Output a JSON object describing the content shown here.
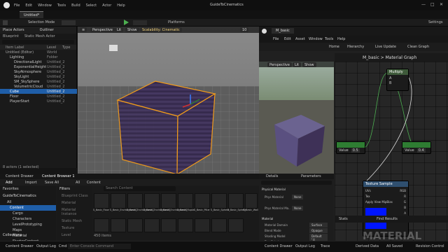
{
  "menu": {
    "items": [
      "File",
      "Edit",
      "Window",
      "Tools",
      "Build",
      "Select",
      "Actor",
      "Help"
    ],
    "project_title": "GuideToCinematics",
    "tab": "Untitled*"
  },
  "toolbar": {
    "selection_mode": "Selection Mode",
    "platforms": "Platforms",
    "settings": "Settings"
  },
  "outliner": {
    "tabs": [
      "Place Actors",
      "Outliner"
    ],
    "subtabs": [
      "Blueprint",
      "Static Mesh Actor"
    ],
    "columns": [
      "Item Label",
      "Level",
      "Type"
    ],
    "rows": [
      {
        "label": "Untitled (Editor)",
        "type": "World"
      },
      {
        "label": "Lighting",
        "type": "Folder"
      },
      {
        "label": "DirectionalLight",
        "type": "Untitled_2"
      },
      {
        "label": "ExponentialHeight",
        "type": "Untitled_2"
      },
      {
        "label": "SkyAtmosphere",
        "type": "Untitled_2"
      },
      {
        "label": "SkyLight",
        "type": "Untitled_2"
      },
      {
        "label": "SM_SkySphere",
        "type": "Untitled_2"
      },
      {
        "label": "VolumetricCloud",
        "type": "Untitled_2"
      },
      {
        "label": "Cube",
        "type": "Untitled_2"
      },
      {
        "label": "Floor",
        "type": "Untitled_2"
      },
      {
        "label": "PlayerStart",
        "type": "Untitled_2"
      }
    ],
    "footer": "8 actors (1 selected)"
  },
  "viewport": {
    "perspective": "Perspective",
    "lit": "Lit",
    "show": "Show",
    "scalability": "Scalability: Cinematic",
    "gizmo_value": "10"
  },
  "material_editor": {
    "tab": "M_basic",
    "menu": [
      "File",
      "Edit",
      "Asset",
      "Window",
      "Tools",
      "Help"
    ],
    "toolbar": [
      "Home",
      "Hierarchy",
      "Live Update",
      "Clean Graph"
    ],
    "graph_title": "M_basic > Material Graph",
    "zoom": "Zoom -1",
    "preview": {
      "perspective": "Perspective",
      "lit": "Lit",
      "show": "Show"
    },
    "details_tabs": [
      "Details",
      "Parameters"
    ],
    "details": {
      "section_physical": "Physical Material",
      "phys_material": "Phys Material",
      "phys_mat_map": "Phys Material Ma..",
      "none": "None",
      "section_material": "Material",
      "material_domain": "Material Domain",
      "surface": "Surface",
      "blend_mode": "Blend Mode",
      "opaque": "Opaque",
      "shading_model": "Shading Model",
      "default_lit": "Default Lit",
      "two_sided": "Two Sided",
      "use_material_attr": "Use Material Attri"
    },
    "nodes": {
      "multiply": "Multiply",
      "a": "A",
      "b": "B",
      "value_label": "Value",
      "v1": "0.5",
      "v2": "0.4",
      "texture_sample": "Texture Sample",
      "uvs": "UVs",
      "tex": "Tex",
      "apply_mip": "Apply View MipBias",
      "rgb": "RGB",
      "r": "R",
      "g": "G",
      "bb": "B",
      "al": "A",
      "rgba": "RGBA"
    },
    "bottom_tabs": [
      "Stats",
      "Find Results"
    ],
    "watermark": "MATERIAL"
  },
  "content": {
    "tabs": [
      "Content Drawer",
      "Content Browser 1"
    ],
    "add": "Add",
    "import": "Import",
    "save_all": "Save All",
    "path": [
      "All",
      "Content"
    ],
    "favorites": "Favorites",
    "project": "GuideToCinematics",
    "tree": [
      "All",
      "Content",
      "Cargo",
      "Characters",
      "LevelPrototyping",
      "Maps",
      "Material",
      "StarterContent"
    ],
    "filters": "Filters",
    "filter_items": [
      "Blueprint Class",
      "Material",
      "Material Instance",
      "Static Mesh",
      "Texture",
      "Level"
    ],
    "search": "Search Content",
    "count": "450 items",
    "collections": "Collections",
    "thumbs": [
      "S_Basic_Floor",
      "S_Basic_EnvironmentC",
      "S_Basic_EnvironmentC",
      "S_Basic_EnvironmentS",
      "S_Basic_EnvironmentS",
      "S_Basic_Rupta",
      "S_Basic_Pillar",
      "S_Basic_Sphere",
      "S_Basic_Sphere",
      "S_Basic_Wall"
    ]
  },
  "statusbar": {
    "content_drawer": "Content Drawer",
    "output_log": "Output Log",
    "cmd": "Cmd",
    "console_placeholder": "Enter Console Command",
    "trace": "Trace",
    "derived_data": "Derived Data",
    "all_saved": "All Saved",
    "revision": "Revision Control"
  },
  "colors": {
    "cube": "#3e3157",
    "selection": "#f29c1a",
    "texture_preview": "#0015ff",
    "accent_green": "#2e7d32"
  }
}
